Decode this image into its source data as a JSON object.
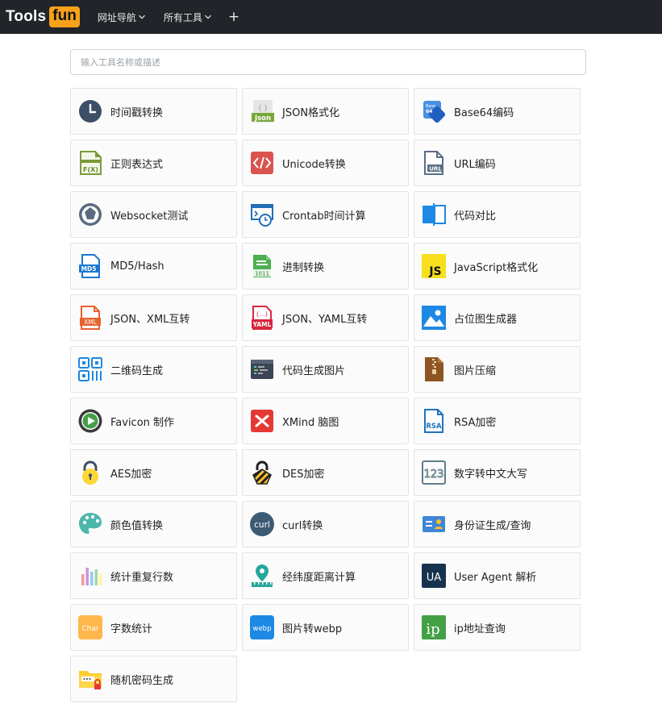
{
  "brand": {
    "name_part1": "Tools",
    "name_part2": "fun",
    "accent": "#f7a21b",
    "navbar_bg": "#212529"
  },
  "nav": {
    "items": [
      {
        "label": "网址导航",
        "icon": "chevron-down-icon"
      },
      {
        "label": "所有工具",
        "icon": "chevron-down-icon"
      }
    ],
    "add_icon": "+"
  },
  "search": {
    "placeholder": "输入工具名称或描述",
    "value": ""
  },
  "tools": [
    {
      "label": "时间戳转换",
      "icon": "clock-icon"
    },
    {
      "label": "JSON格式化",
      "icon": "json-file-icon"
    },
    {
      "label": "Base64编码",
      "icon": "base64-icon"
    },
    {
      "label": "正则表达式",
      "icon": "regex-file-icon"
    },
    {
      "label": "Unicode转换",
      "icon": "code-tag-icon"
    },
    {
      "label": "URL编码",
      "icon": "url-file-icon"
    },
    {
      "label": "Websocket测试",
      "icon": "socket-icon"
    },
    {
      "label": "Crontab时间计算",
      "icon": "crontab-icon"
    },
    {
      "label": "代码对比",
      "icon": "diff-icon"
    },
    {
      "label": "MD5/Hash",
      "icon": "md5-file-icon"
    },
    {
      "label": "进制转换",
      "icon": "binary-file-icon"
    },
    {
      "label": "JavaScript格式化",
      "icon": "javascript-icon"
    },
    {
      "label": "JSON、XML互转",
      "icon": "xml-file-icon"
    },
    {
      "label": "JSON、YAML互转",
      "icon": "yaml-file-icon"
    },
    {
      "label": "占位图生成器",
      "icon": "image-placeholder-icon"
    },
    {
      "label": "二维码生成",
      "icon": "qrcode-icon"
    },
    {
      "label": "代码生成图片",
      "icon": "code-image-icon"
    },
    {
      "label": "图片压缩",
      "icon": "zip-file-icon"
    },
    {
      "label": "Favicon 制作",
      "icon": "favicon-icon"
    },
    {
      "label": "XMind 脑图",
      "icon": "xmind-icon"
    },
    {
      "label": "RSA加密",
      "icon": "rsa-file-icon"
    },
    {
      "label": "AES加密",
      "icon": "aes-lock-icon"
    },
    {
      "label": "DES加密",
      "icon": "des-lock-icon"
    },
    {
      "label": "数字转中文大写",
      "icon": "number-123-icon"
    },
    {
      "label": "颜色值转换",
      "icon": "palette-icon"
    },
    {
      "label": "curl转换",
      "icon": "curl-icon"
    },
    {
      "label": "身份证生成/查询",
      "icon": "id-card-icon"
    },
    {
      "label": "统计重复行数",
      "icon": "bar-stats-icon"
    },
    {
      "label": "经纬度距离计算",
      "icon": "map-pin-icon"
    },
    {
      "label": "User Agent 解析",
      "icon": "ua-icon"
    },
    {
      "label": "字数统计",
      "icon": "char-count-icon"
    },
    {
      "label": "图片转webp",
      "icon": "webp-icon"
    },
    {
      "label": "ip地址查询",
      "icon": "ip-icon"
    },
    {
      "label": "随机密码生成",
      "icon": "password-folder-icon"
    }
  ]
}
